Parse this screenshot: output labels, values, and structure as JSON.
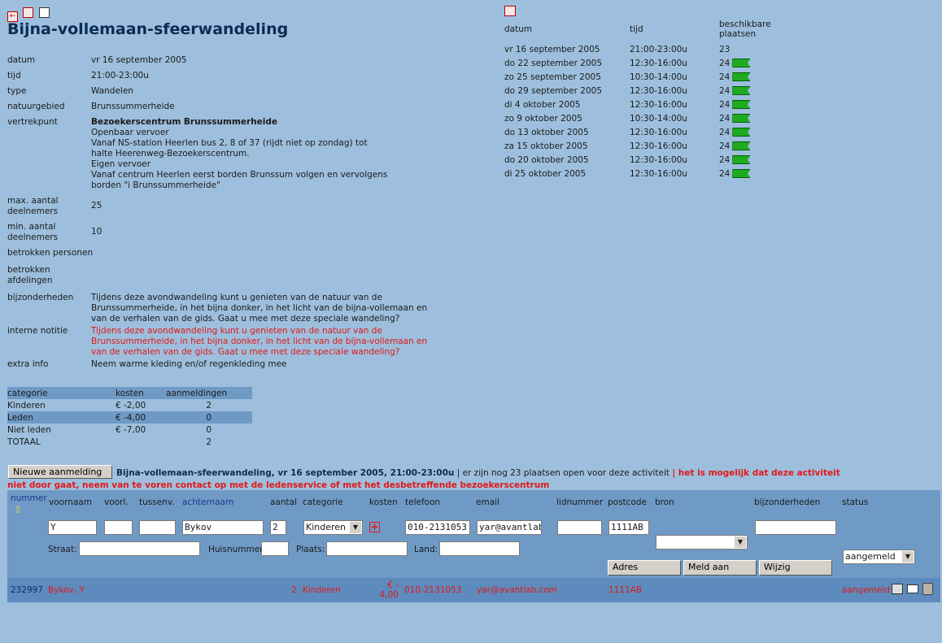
{
  "activity": {
    "title": "Bijna-vollemaan-sfeerwandeling",
    "details": [
      {
        "label": "datum",
        "value": "vr 16 september 2005"
      },
      {
        "label": "tijd",
        "value": "21:00-23:00u"
      },
      {
        "label": "type",
        "value": "Wandelen"
      },
      {
        "label": "natuurgebied",
        "value": "Brunssummerheide"
      }
    ],
    "vertrekpunt": {
      "label": "vertrekpunt",
      "name": "Bezoekerscentrum Brunssummerheide",
      "lines": [
        "Openbaar vervoer",
        "Vanaf NS-station Heerlen bus 2, 8 of 37 (rijdt niet op zondag) tot halte Heerenweg-Bezoekerscentrum.",
        "Eigen vervoer",
        "Vanaf centrum Heerlen eerst borden Brunssum volgen en vervolgens borden \"i Brunssummerheide\""
      ]
    },
    "max_label": "max. aantal deelnemers",
    "max_value": "25",
    "min_label": "min. aantal deelnemers",
    "min_value": "10",
    "persons_label": "betrokken personen",
    "depts_label": "betrokken afdelingen",
    "special_label": "bijzonderheden",
    "special_value": "Tijdens deze avondwandeling kunt u genieten van de natuur van de Brunssummerheide, in het bijna donker, in het licht van de bijna-vollemaan en van de verhalen van de gids. Gaat u mee met deze speciale wandeling?",
    "note_label": "interne notitie",
    "note_value": "Tijdens deze avondwandeling kunt u genieten van de natuur van de Brunssummerheide, in het bijna donker, in het licht van de bijna-vollemaan en van de verhalen van de gids. Gaat u mee met deze speciale wandeling?",
    "extra_label": "extra info",
    "extra_value": "Neem warme kleding en/of regenkleding mee"
  },
  "costs": {
    "headers": [
      "categorie",
      "kosten",
      "aanmeldingen"
    ],
    "rows": [
      [
        "Kinderen",
        "€ -2,00",
        "2"
      ],
      [
        "Leden",
        "€ -4,00",
        "0"
      ],
      [
        "Niet leden",
        "€ -7,00",
        "0"
      ],
      [
        "TOTAAL",
        "",
        "2"
      ]
    ]
  },
  "dates": {
    "headers": [
      "datum",
      "tijd",
      "beschikbare plaatsen"
    ],
    "rows": [
      [
        "vr 16 september 2005",
        "21:00-23:00u",
        "23"
      ],
      [
        "do 22 september 2005",
        "12:30-16:00u",
        "24"
      ],
      [
        "zo 25 september 2005",
        "10:30-14:00u",
        "24"
      ],
      [
        "do 29 september 2005",
        "12:30-16:00u",
        "24"
      ],
      [
        "di 4 oktober 2005",
        "12:30-16:00u",
        "24"
      ],
      [
        "zo 9 oktober 2005",
        "10:30-14:00u",
        "24"
      ],
      [
        "do 13 oktober 2005",
        "12:30-16:00u",
        "24"
      ],
      [
        "za 15 oktober 2005",
        "12:30-16:00u",
        "24"
      ],
      [
        "do 20 oktober 2005",
        "12:30-16:00u",
        "24"
      ],
      [
        "di 25 oktober 2005",
        "12:30-16:00u",
        "24"
      ]
    ]
  },
  "registration": {
    "new_button": "Nieuwe aanmelding",
    "summary_bold": "Bijna-vollemaan-sfeerwandeling, vr 16 september 2005, 21:00-23:00u",
    "summary_sep": " | er zijn nog 23 plaatsen open voor deze activiteit ",
    "warning_1": "| het is mogelijk dat deze activiteit",
    "warning_2": "niet door gaat, neem van te voren contact op met de ledenservice of met het desbetreffende bezoekerscentrum",
    "headers": {
      "nummer": "nummer",
      "voornaam": "voornaam",
      "voorl": "voorl.",
      "tussenv": "tussenv.",
      "achternaam": "achternaam",
      "aantal": "aantal",
      "categorie": "categorie",
      "kosten": "kosten",
      "telefoon": "telefoon",
      "email": "email",
      "lidnummer": "lidnummer",
      "postcode": "postcode",
      "bron": "bron",
      "bijzonderheden": "bijzonderheden",
      "status": "status"
    },
    "values": {
      "voornaam": "Y",
      "voorl": "",
      "tussenv": "",
      "achternaam": "Bykov",
      "aantal": "2",
      "categorie": "Kinderen",
      "telefoon": "010-2131053",
      "email": "yar@avantlab",
      "lidnummer": "",
      "postcode": "1111AB",
      "bron": "",
      "bijzonderheden": "",
      "status": "aangemeld"
    },
    "address": {
      "straat": "Straat:",
      "huisnummer": "Huisnummer:",
      "plaats": "Plaats:",
      "land": "Land:"
    },
    "buttons": {
      "adres": "Adres",
      "meld_aan": "Meld aan",
      "wijzig": "Wijzig"
    }
  },
  "result": {
    "nummer": "232997",
    "naam": "Bykov, Y",
    "aantal": "2",
    "categorie": "Kinderen",
    "kosten_1": "€ -",
    "kosten_2": "4,00",
    "telefoon": "010-2131053",
    "email": "yar@avantlab.com",
    "postcode": "1111AB",
    "status": "aangemeld"
  }
}
